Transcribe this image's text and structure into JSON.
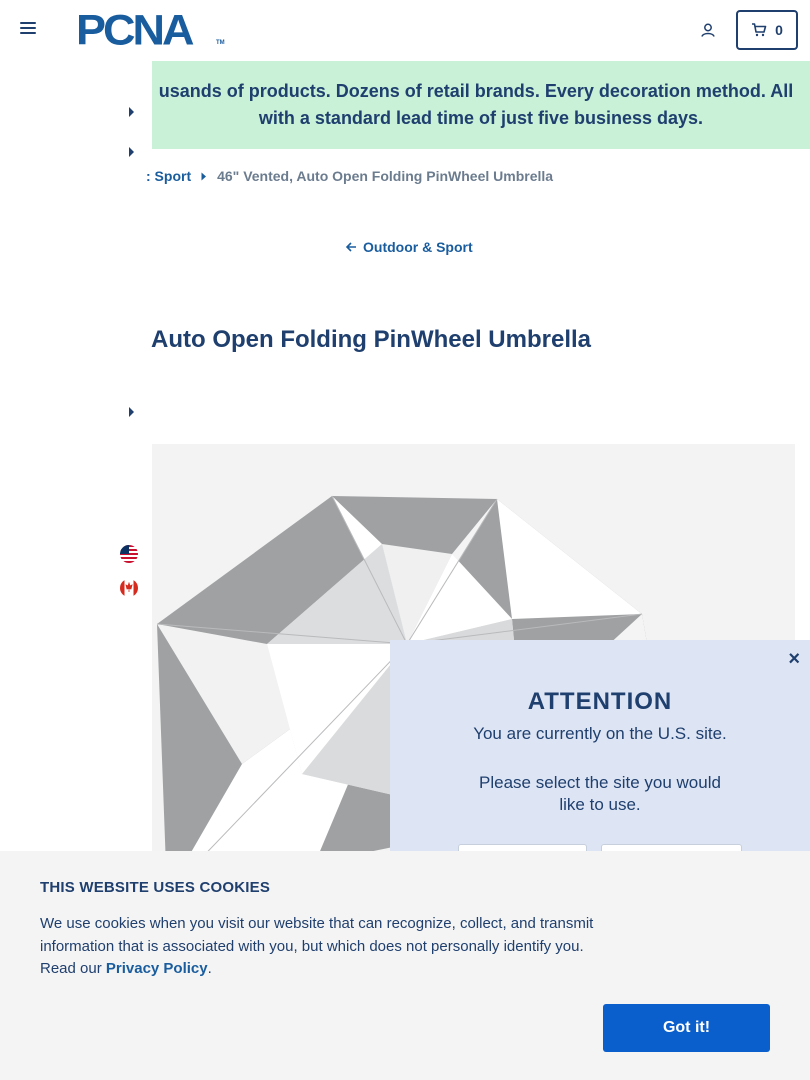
{
  "header": {
    "logo_text": "PCNA",
    "logo_tm": "TM",
    "cart_count": "0"
  },
  "banner": {
    "line1": "usands of products. Dozens of retail brands. Every decoration method. All",
    "line2": "with a standard lead time of just five business days."
  },
  "breadcrumb": {
    "parent": ": Sport",
    "current": "46\" Vented, Auto Open Folding PinWheel Umbrella"
  },
  "back_link": "Outdoor & Sport",
  "product": {
    "title": "Auto Open Folding PinWheel Umbrella"
  },
  "attention": {
    "title": "ATTENTION",
    "message": "You are currently on the U.S. site.",
    "prompt": "Please select the site you would like to use.",
    "close": "×"
  },
  "cookie": {
    "title": "THIS WEBSITE USES COOKIES",
    "body": "We use cookies when you visit our website that can recognize, collect, and transmit information that is associated with you, but which does not personally identify you. Read our ",
    "link": "Privacy Policy",
    "period": ".",
    "button": "Got it!"
  },
  "icons": {
    "menu": "hamburger-icon",
    "account": "user-icon",
    "cart": "cart-icon",
    "flag_us": "us-flag-icon",
    "flag_ca": "canada-flag-icon"
  },
  "colors": {
    "primary": "#1f3f6e",
    "brand": "#1a5d9e",
    "banner_bg": "#c9f1d8",
    "popup_bg": "#dde5f4",
    "cookie_button": "#0b5fcc"
  }
}
